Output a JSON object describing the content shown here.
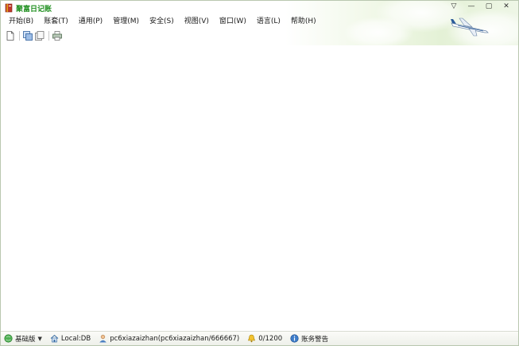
{
  "app": {
    "title": "聚富日记账"
  },
  "window_controls": {
    "help": "▽",
    "minimize": "—",
    "maximize": "▢",
    "close": "✕"
  },
  "menu": [
    {
      "label": "开始(B)"
    },
    {
      "label": "账套(T)"
    },
    {
      "label": "通用(P)"
    },
    {
      "label": "管理(M)"
    },
    {
      "label": "安全(S)"
    },
    {
      "label": "视图(V)"
    },
    {
      "label": "窗口(W)"
    },
    {
      "label": "语言(L)"
    },
    {
      "label": "帮助(H)"
    }
  ],
  "toolbar": {
    "icons": [
      "new-document-icon",
      "copy-window-icon",
      "pages-icon",
      "print-icon"
    ]
  },
  "status": {
    "edition": "基础版",
    "location": "Local:DB",
    "user": "pc6xiazaizhan(pc6xiazaizhan/666667)",
    "counter": "0/1200",
    "alert": "账务警告"
  },
  "colors": {
    "title": "#1f8f1f",
    "border": "#b9c7b0"
  }
}
